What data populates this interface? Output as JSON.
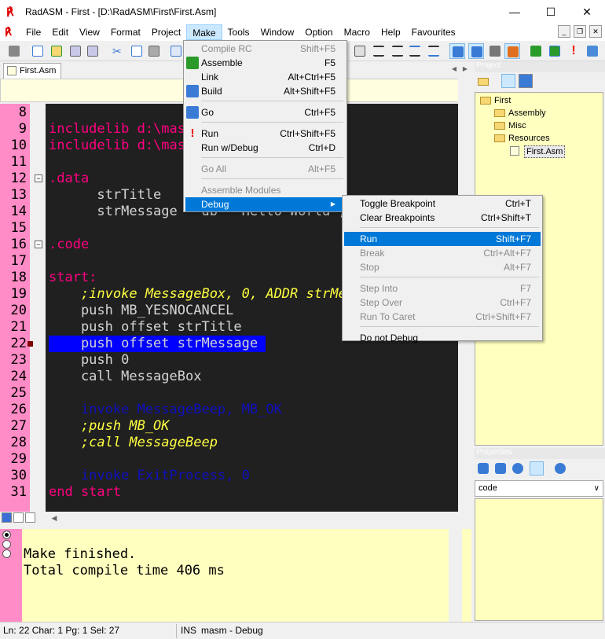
{
  "window": {
    "title": "RadASM - First - [D:\\RadASM\\First\\First.Asm]",
    "app_logo": "radasm-logo",
    "min": "—",
    "max": "☐",
    "close": "✕"
  },
  "menubar": {
    "items": [
      "File",
      "Edit",
      "View",
      "Format",
      "Project",
      "Make",
      "Tools",
      "Window",
      "Option",
      "Macro",
      "Help",
      "Favourites"
    ],
    "active": "Make",
    "mdi": [
      "_",
      "❐",
      "✕"
    ]
  },
  "editor": {
    "tab": "First.Asm",
    "lines": [
      {
        "num": "8",
        "text": ""
      },
      {
        "num": "9",
        "text": "includelib d:\\masm32\\lib\\kernel32.lib"
      },
      {
        "num": "10",
        "text": "includelib d:\\masm32\\lib\\user32.lib"
      },
      {
        "num": "11",
        "text": ""
      },
      {
        "num": "12",
        "text": ".data"
      },
      {
        "num": "13",
        "text": "      strTitle     db  'First',0"
      },
      {
        "num": "14",
        "text": "      strMessage   db  'Hello World',0"
      },
      {
        "num": "15",
        "text": ""
      },
      {
        "num": "16",
        "text": ".code"
      },
      {
        "num": "17",
        "text": ""
      },
      {
        "num": "18",
        "text": "start:"
      },
      {
        "num": "19",
        "text": "    ;invoke MessageBox, 0, ADDR strMessage"
      },
      {
        "num": "20",
        "text": "    push MB_YESNOCANCEL"
      },
      {
        "num": "21",
        "text": "    push offset strTitle"
      },
      {
        "num": "22",
        "text": "    push offset strMessage "
      },
      {
        "num": "23",
        "text": "    push 0"
      },
      {
        "num": "24",
        "text": "    call MessageBox"
      },
      {
        "num": "25",
        "text": ""
      },
      {
        "num": "26",
        "text": "    invoke MessageBeep, MB_OK"
      },
      {
        "num": "27",
        "text": "    ;push MB_OK"
      },
      {
        "num": "28",
        "text": "    ;call MessageBeep"
      },
      {
        "num": "29",
        "text": ""
      },
      {
        "num": "30",
        "text": "    invoke ExitProcess, 0"
      },
      {
        "num": "31",
        "text": "end start"
      }
    ]
  },
  "output": {
    "lines": "Make finished.\nTotal compile time 406 ms"
  },
  "statusbar": {
    "position": "Ln: 22 Char: 1 Pg: 1 Sel: 27",
    "mode": "INS",
    "build": "masm - Debug"
  },
  "project": {
    "header": "Project",
    "tree": {
      "root": "First",
      "assembly": "Assembly",
      "misc": "Misc",
      "resources": "Resources",
      "file": "First.Asm"
    }
  },
  "properties": {
    "header": "Properties",
    "combo_value": "code"
  },
  "make_menu": {
    "items": [
      {
        "label": "Compile RC",
        "shortcut": "Shift+F5",
        "disabled": true
      },
      {
        "label": "Assemble",
        "shortcut": "F5",
        "disabled": false
      },
      {
        "label": "Link",
        "shortcut": "Alt+Ctrl+F5",
        "disabled": false
      },
      {
        "label": "Build",
        "shortcut": "Alt+Shift+F5",
        "disabled": false
      },
      {
        "label": "Go",
        "shortcut": "Ctrl+F5",
        "disabled": false
      },
      {
        "label": "Run",
        "shortcut": "Ctrl+Shift+F5",
        "disabled": false
      },
      {
        "label": "Run w/Debug",
        "shortcut": "Ctrl+D",
        "disabled": false
      },
      {
        "label": "Go All",
        "shortcut": "Alt+F5",
        "disabled": true
      },
      {
        "label": "Assemble Modules",
        "shortcut": "",
        "disabled": true
      },
      {
        "label": "Debug",
        "shortcut": "▶",
        "disabled": false
      }
    ]
  },
  "debug_menu": {
    "items": [
      {
        "label": "Toggle Breakpoint",
        "shortcut": "Ctrl+T",
        "disabled": false
      },
      {
        "label": "Clear Breakpoints",
        "shortcut": "Ctrl+Shift+T",
        "disabled": false
      },
      {
        "label": "Run",
        "shortcut": "Shift+F7",
        "disabled": false
      },
      {
        "label": "Break",
        "shortcut": "Ctrl+Alt+F7",
        "disabled": true
      },
      {
        "label": "Stop",
        "shortcut": "Alt+F7",
        "disabled": true
      },
      {
        "label": "Step Into",
        "shortcut": "F7",
        "disabled": true
      },
      {
        "label": "Step Over",
        "shortcut": "Ctrl+F7",
        "disabled": true
      },
      {
        "label": "Run To Caret",
        "shortcut": "Ctrl+Shift+F7",
        "disabled": true
      },
      {
        "label": "Do not Debug",
        "shortcut": "",
        "disabled": false
      }
    ]
  },
  "colors": {
    "gutter": "#ff8cc6",
    "editor_bg": "#202020",
    "keyword": "#ff0080",
    "directive": "#0000ff",
    "comment": "#ffff40",
    "menu_highlight": "#0078d7"
  }
}
